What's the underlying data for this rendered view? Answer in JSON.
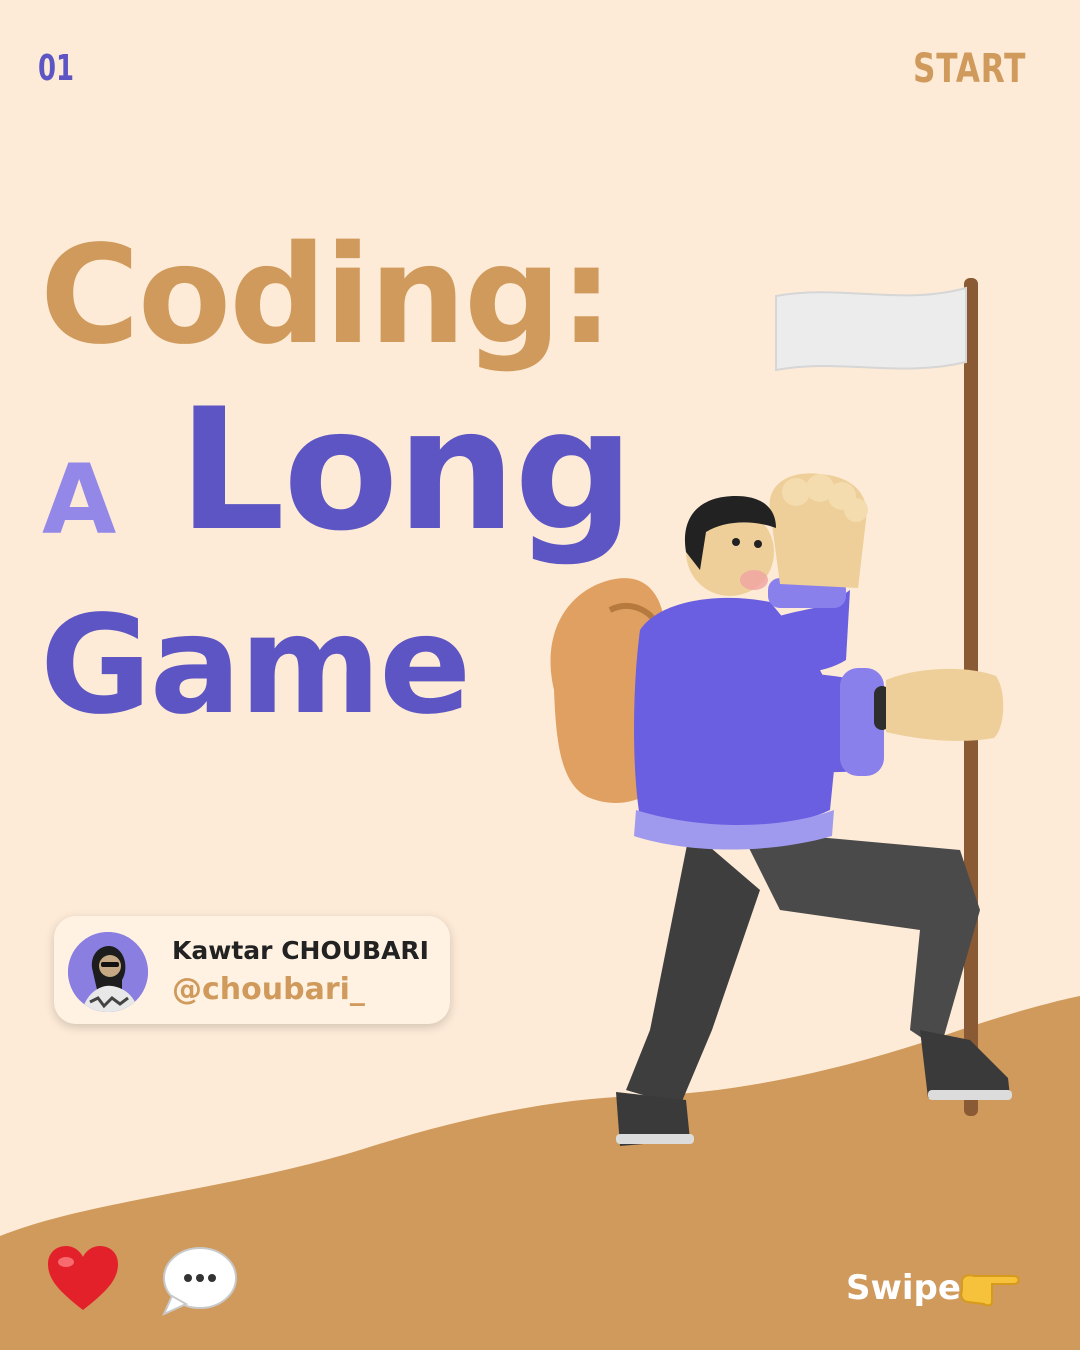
{
  "header": {
    "page_number": "01",
    "start_label": "START"
  },
  "title": {
    "line1": "Coding:",
    "line2_prefix": "A",
    "line2": "Long",
    "line3": "Game"
  },
  "author": {
    "name": "Kawtar CHOUBARI",
    "handle": "@choubari_"
  },
  "footer": {
    "swipe_label": "Swipe"
  },
  "icons": {
    "like": "heart-icon",
    "comment": "speech-bubble-icon",
    "swipe": "pointing-hand-icon"
  },
  "colors": {
    "background": "#fdebd7",
    "accent_tan": "#cf9a5b",
    "accent_purple": "#5d55c4",
    "accent_lavender": "#9388e8"
  }
}
